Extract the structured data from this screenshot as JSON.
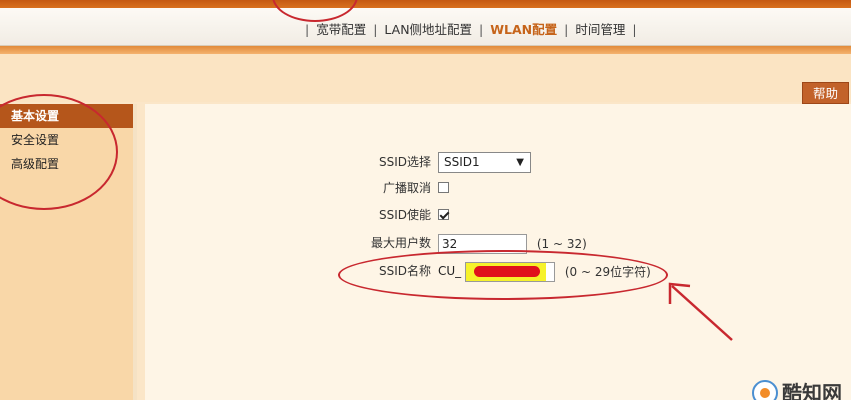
{
  "nav": {
    "tabs": [
      {
        "label": "宽带配置",
        "active": false
      },
      {
        "label": "LAN侧地址配置",
        "active": false
      },
      {
        "label": "WLAN配置",
        "active": true
      },
      {
        "label": "时间管理",
        "active": false
      }
    ],
    "separator": "|"
  },
  "help_label": "帮助",
  "sidebar": {
    "items": [
      {
        "label": "基本设置",
        "active": true
      },
      {
        "label": "安全设置",
        "active": false
      },
      {
        "label": "高级配置",
        "active": false
      }
    ]
  },
  "form": {
    "ssid_select": {
      "label": "SSID选择",
      "value": "SSID1"
    },
    "broadcast_cancel": {
      "label": "广播取消",
      "checked": false
    },
    "ssid_enable": {
      "label": "SSID使能",
      "checked": true
    },
    "max_users": {
      "label": "最大用户数",
      "value": "32",
      "hint": "(1 ~ 32)"
    },
    "ssid_name": {
      "label": "SSID名称",
      "prefix": "CU_",
      "hint": "(0 ~ 29位字符)"
    }
  },
  "watermark": {
    "text": "酷知网"
  },
  "colors": {
    "accent_orange": "#c6641a",
    "sidebar_active": "#b5561b",
    "annotation_red": "#c8282f"
  }
}
